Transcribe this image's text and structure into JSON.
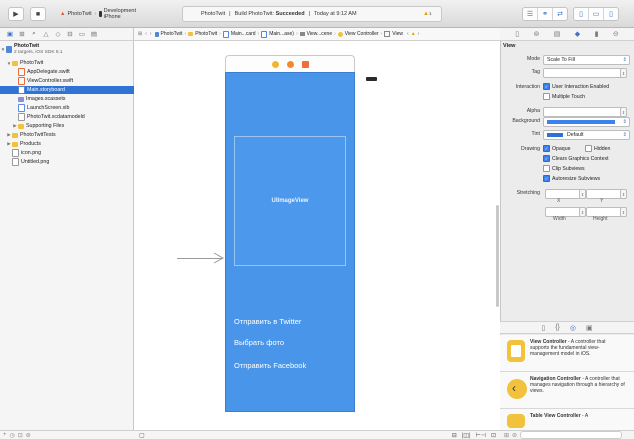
{
  "toolbar": {
    "scheme": "PhotoTwit",
    "device": "Development iPhone",
    "activity_project": "PhotoTwit",
    "activity_build_prefix": "Build PhotoTwit:",
    "activity_build_status": "Succeeded",
    "activity_time": "Today at 9:12 AM",
    "warnings": "1"
  },
  "navigator": {
    "project_name": "PhotoTwit",
    "project_sub": "2 targets, iOS SDK 8.1",
    "items": [
      {
        "label": "PhotoTwit",
        "icon": "folder",
        "level": 1,
        "open": true
      },
      {
        "label": "AppDelegate.swift",
        "icon": "swift",
        "level": 2
      },
      {
        "label": "ViewController.swift",
        "icon": "swift",
        "level": 2
      },
      {
        "label": "Main.storyboard",
        "icon": "storyboard",
        "level": 2,
        "selected": true
      },
      {
        "label": "Images.xcassets",
        "icon": "xcassets",
        "level": 2
      },
      {
        "label": "LaunchScreen.xib",
        "icon": "xib",
        "level": 2
      },
      {
        "label": "PhotoTwit.xcdatamodeld",
        "icon": "datamodel",
        "level": 2
      },
      {
        "label": "Supporting Files",
        "icon": "folder",
        "level": 2,
        "closed": true
      },
      {
        "label": "PhotoTwitTests",
        "icon": "folder",
        "level": 1,
        "closed": true
      },
      {
        "label": "Products",
        "icon": "folder",
        "level": 1,
        "closed": true
      },
      {
        "label": "icon.png",
        "icon": "file",
        "level": 1
      },
      {
        "label": "Untitled.png",
        "icon": "file",
        "level": 1
      }
    ]
  },
  "jumpbar": {
    "items": [
      "PhotoTwit",
      "PhotoTwit",
      "Main...card",
      "Main...ase)",
      "View...cene",
      "View Controller",
      "View"
    ]
  },
  "scene": {
    "imageview_label": "UIImageView",
    "buttons": [
      "Отправить в Twitter",
      "Выбрать фото",
      "Отправить Facebook"
    ]
  },
  "inspector": {
    "section": "View",
    "mode_label": "Mode",
    "mode_value": "Scale To Fill",
    "tag_label": "Tag",
    "tag_value": "0",
    "interaction_label": "Interaction",
    "user_interaction": "User Interaction Enabled",
    "multiple_touch": "Multiple Touch",
    "alpha_label": "Alpha",
    "alpha_value": "1",
    "background_label": "Background",
    "tint_label": "Tint",
    "tint_value": "Default",
    "drawing_label": "Drawing",
    "opaque": "Opaque",
    "hidden": "Hidden",
    "clears_graphics": "Clears Graphics Context",
    "clip_subviews": "Clip Subviews",
    "autoresize": "Autoresize Subviews",
    "stretching_label": "Stretching",
    "stretch_x": "0",
    "stretch_y": "0",
    "stretch_width": "1",
    "stretch_height": "1",
    "x_label": "X",
    "y_label": "Y",
    "width_label": "Width",
    "height_label": "Height",
    "colors": {
      "background": "#3b82f0",
      "tint": "#2f6fd6"
    }
  },
  "library": {
    "items": [
      {
        "title": "View Controller",
        "desc": " - A controller that supports the fundamental view-management model in iOS."
      },
      {
        "title": "Navigation Controller",
        "desc": " - A controller that manages navigation through a hierarchy of views."
      },
      {
        "title": "Table View Controller",
        "desc": " - A"
      }
    ]
  }
}
